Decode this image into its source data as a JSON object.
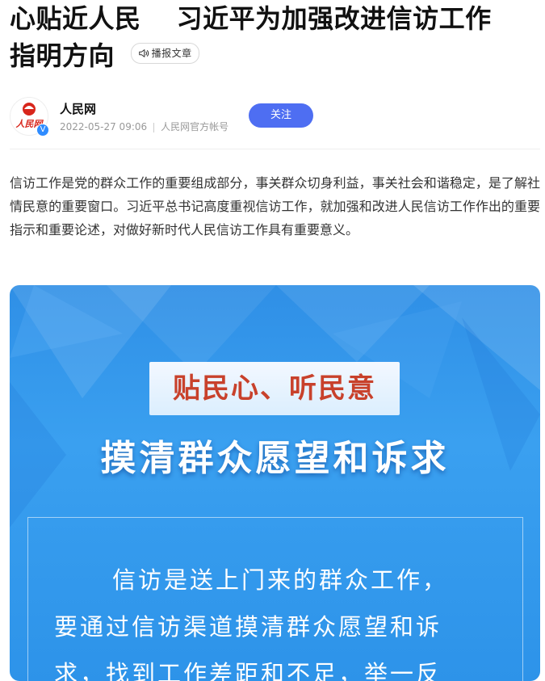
{
  "article": {
    "title_part1": "心贴近人民　 习近平为加强改进信访工作",
    "title_part2": "指明方向",
    "broadcast_label": "播报文章"
  },
  "author": {
    "avatar_text": "人民网",
    "name": "人民网",
    "datetime": "2022-05-27 09:06",
    "account_type": "人民网官方帐号",
    "follow_label": "关注",
    "verified_badge": "V"
  },
  "body": {
    "lead": "信访工作是党的群众工作的重要组成部分，事关群众切身利益，事关社会和谐稳定，是了解社情民意的重要窗口。习近平总书记高度重视信访工作，就加强和改进人民信访工作作出的重要指示和重要论述，对做好新时代人民信访工作具有重要意义。"
  },
  "poster": {
    "banner": "贴民心、听民意",
    "headline": "摸清群众愿望和诉求",
    "text_line1": "信访是送上门来的群众工作，",
    "text_line2": "要通过信访渠道摸清群众愿望和诉",
    "text_line3": "求，找到工作差距和不足，举一反"
  },
  "colors": {
    "follow_button": "#4e6ef2",
    "poster_blue": "#2f8fe6",
    "banner_red": "#c8412b",
    "verified_blue": "#2f8cff"
  },
  "icons": {
    "broadcast": "speaker-icon",
    "avatar": "people-daily-logo"
  }
}
